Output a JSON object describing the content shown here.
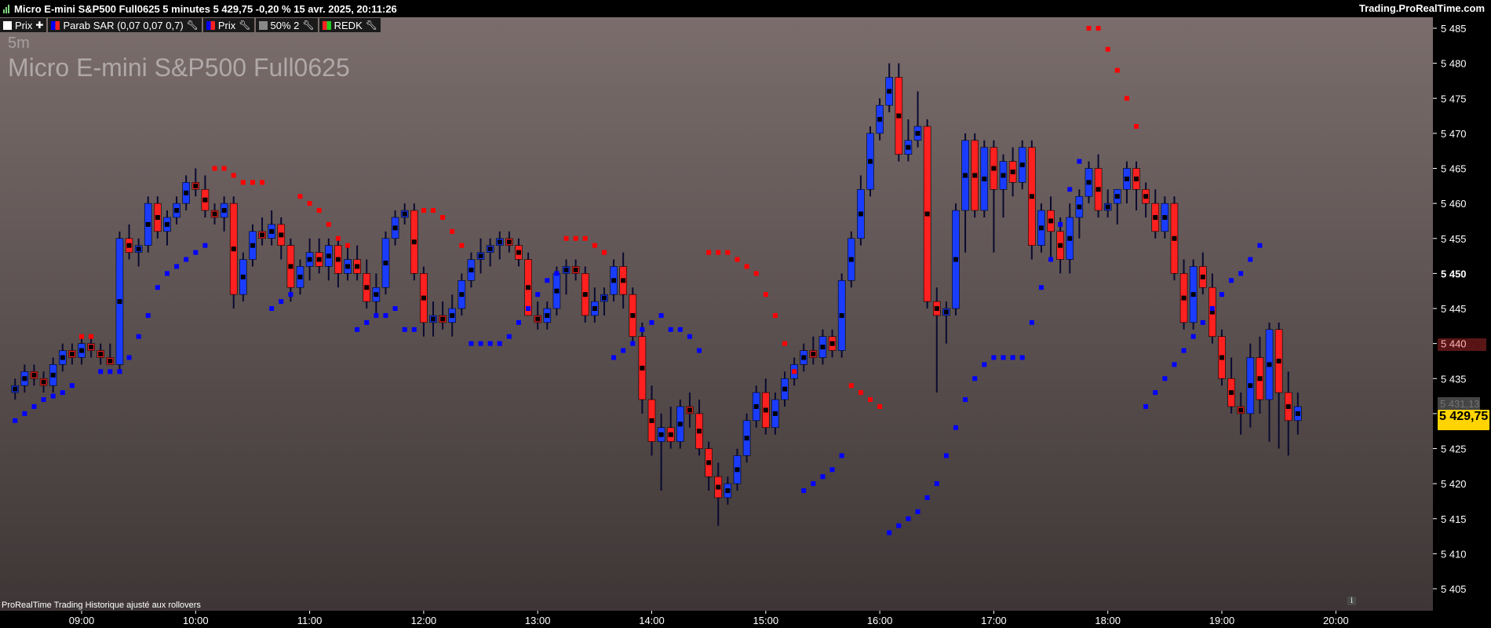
{
  "title": "Micro E-mini S&P500 Full0625 5 minutes 5 429,75 -0,20 % 15 avr. 2025, 20:11:26",
  "site": "Trading.ProRealTime.com",
  "legend": [
    {
      "label": "Prix",
      "swatch": "white",
      "tool": "plus-icon"
    },
    {
      "label": "Parab SAR (0,07 0,07 0,7)",
      "swatch": "split",
      "tool": "wrench-icon"
    },
    {
      "label": "Prix",
      "swatch": "split",
      "tool": "wrench-icon"
    },
    {
      "label": "50% 2",
      "swatch": "grey",
      "tool": "wrench-icon"
    },
    {
      "label": "REDK",
      "swatch": "rg",
      "tool": "wrench-icon"
    }
  ],
  "timeframe": "5m",
  "instrument": "Micro E-mini S&P500 Full0625",
  "footer": "ProRealTime Trading  Historique ajusté aux rollovers",
  "info_icon": "info-icon",
  "price_label": "5 429,75",
  "sar_label": "5 439,75",
  "mid_label": "5 431,13",
  "colors": {
    "up": "#1a3cff",
    "down": "#ff2020",
    "sar_up": "#0000ff",
    "sar_down": "#ff0000",
    "bar_mark": "#000000"
  },
  "chart_data": {
    "type": "candlestick",
    "y_ticks": [
      "5 405",
      "5 410",
      "5 415",
      "5 420",
      "5 425",
      "5 430",
      "5 435",
      "5 440",
      "5 445",
      "5 450",
      "5 455",
      "5 460",
      "5 465",
      "5 470",
      "5 475",
      "5 480",
      "5 485"
    ],
    "y_tick_values": [
      5405,
      5410,
      5415,
      5420,
      5425,
      5430,
      5435,
      5440,
      5445,
      5450,
      5455,
      5460,
      5465,
      5470,
      5475,
      5480,
      5485
    ],
    "x_ticks": [
      "09:00",
      "10:00",
      "11:00",
      "12:00",
      "13:00",
      "14:00",
      "15:00",
      "16:00",
      "17:00",
      "18:00",
      "19:00",
      "20:00"
    ],
    "ylim": [
      5402,
      5489
    ],
    "bars_per_hour": 12,
    "first_bar_offset_from_0900": -7,
    "ohlc": [
      [
        5433,
        5435,
        5432,
        5434
      ],
      [
        5434,
        5437,
        5433,
        5436
      ],
      [
        5436,
        5437,
        5434,
        5435
      ],
      [
        5435,
        5436,
        5433,
        5434
      ],
      [
        5434,
        5438,
        5433,
        5437
      ],
      [
        5437,
        5440,
        5436,
        5439
      ],
      [
        5439,
        5440,
        5437,
        5438
      ],
      [
        5438,
        5441,
        5437,
        5440
      ],
      [
        5440,
        5441,
        5438,
        5439
      ],
      [
        5439,
        5440,
        5437,
        5438
      ],
      [
        5438,
        5440,
        5437,
        5437
      ],
      [
        5437,
        5456,
        5436,
        5455
      ],
      [
        5455,
        5457,
        5452,
        5453
      ],
      [
        5453,
        5455,
        5451,
        5454
      ],
      [
        5454,
        5461,
        5453,
        5460
      ],
      [
        5460,
        5461,
        5455,
        5456
      ],
      [
        5456,
        5459,
        5454,
        5458
      ],
      [
        5458,
        5461,
        5457,
        5460
      ],
      [
        5460,
        5464,
        5459,
        5463
      ],
      [
        5463,
        5465,
        5461,
        5462
      ],
      [
        5462,
        5464,
        5458,
        5459
      ],
      [
        5459,
        5460,
        5457,
        5458
      ],
      [
        5458,
        5461,
        5456,
        5460
      ],
      [
        5460,
        5461,
        5445,
        5447
      ],
      [
        5447,
        5453,
        5446,
        5452
      ],
      [
        5452,
        5457,
        5451,
        5456
      ],
      [
        5456,
        5458,
        5454,
        5455
      ],
      [
        5455,
        5459,
        5454,
        5457
      ],
      [
        5457,
        5458,
        5452,
        5454
      ],
      [
        5454,
        5455,
        5446,
        5448
      ],
      [
        5448,
        5452,
        5447,
        5451
      ],
      [
        5451,
        5455,
        5449,
        5453
      ],
      [
        5453,
        5455,
        5450,
        5451
      ],
      [
        5451,
        5455,
        5449,
        5454
      ],
      [
        5454,
        5455,
        5448,
        5450
      ],
      [
        5450,
        5454,
        5449,
        5452
      ],
      [
        5452,
        5454,
        5449,
        5450
      ],
      [
        5450,
        5452,
        5445,
        5446
      ],
      [
        5446,
        5450,
        5444,
        5448
      ],
      [
        5448,
        5456,
        5447,
        5455
      ],
      [
        5455,
        5459,
        5454,
        5458
      ],
      [
        5458,
        5460,
        5457,
        5459
      ],
      [
        5459,
        5460,
        5449,
        5450
      ],
      [
        5450,
        5451,
        5441,
        5443
      ],
      [
        5443,
        5446,
        5441,
        5444
      ],
      [
        5444,
        5446,
        5442,
        5443
      ],
      [
        5443,
        5447,
        5441,
        5445
      ],
      [
        5445,
        5450,
        5444,
        5449
      ],
      [
        5449,
        5453,
        5448,
        5452
      ],
      [
        5452,
        5455,
        5450,
        5453
      ],
      [
        5453,
        5455,
        5451,
        5454
      ],
      [
        5454,
        5456,
        5452,
        5455
      ],
      [
        5455,
        5456,
        5453,
        5454
      ],
      [
        5454,
        5455,
        5451,
        5452
      ],
      [
        5452,
        5453,
        5447,
        5444
      ],
      [
        5444,
        5446,
        5442,
        5443
      ],
      [
        5443,
        5446,
        5442,
        5445
      ],
      [
        5445,
        5451,
        5444,
        5450
      ],
      [
        5450,
        5452,
        5447,
        5451
      ],
      [
        5451,
        5452,
        5449,
        5450
      ],
      [
        5450,
        5451,
        5443,
        5444
      ],
      [
        5444,
        5448,
        5443,
        5446
      ],
      [
        5446,
        5448,
        5444,
        5447
      ],
      [
        5447,
        5452,
        5446,
        5451
      ],
      [
        5451,
        5453,
        5445,
        5447
      ],
      [
        5447,
        5448,
        5440,
        5441
      ],
      [
        5441,
        5443,
        5430,
        5432
      ],
      [
        5432,
        5434,
        5424,
        5426
      ],
      [
        5426,
        5430,
        5419,
        5428
      ],
      [
        5428,
        5431,
        5425,
        5426
      ],
      [
        5426,
        5432,
        5425,
        5431
      ],
      [
        5431,
        5433,
        5428,
        5430
      ],
      [
        5430,
        5432,
        5424,
        5425
      ],
      [
        5425,
        5426,
        5419,
        5421
      ],
      [
        5421,
        5423,
        5414,
        5418
      ],
      [
        5418,
        5421,
        5417,
        5420
      ],
      [
        5420,
        5425,
        5419,
        5424
      ],
      [
        5424,
        5430,
        5423,
        5429
      ],
      [
        5429,
        5434,
        5428,
        5433
      ],
      [
        5433,
        5435,
        5427,
        5428
      ],
      [
        5428,
        5433,
        5427,
        5432
      ],
      [
        5432,
        5436,
        5431,
        5435
      ],
      [
        5435,
        5438,
        5434,
        5437
      ],
      [
        5437,
        5440,
        5436,
        5439
      ],
      [
        5439,
        5441,
        5437,
        5438
      ],
      [
        5438,
        5442,
        5437,
        5441
      ],
      [
        5441,
        5442,
        5438,
        5439
      ],
      [
        5439,
        5450,
        5438,
        5449
      ],
      [
        5449,
        5456,
        5448,
        5455
      ],
      [
        5455,
        5464,
        5454,
        5462
      ],
      [
        5462,
        5471,
        5461,
        5470
      ],
      [
        5470,
        5475,
        5469,
        5474
      ],
      [
        5474,
        5480,
        5473,
        5478
      ],
      [
        5478,
        5480,
        5466,
        5467
      ],
      [
        5467,
        5472,
        5466,
        5469
      ],
      [
        5469,
        5476,
        5468,
        5471
      ],
      [
        5471,
        5472,
        5445,
        5446
      ],
      [
        5446,
        5448,
        5433,
        5444
      ],
      [
        5444,
        5446,
        5440,
        5445
      ],
      [
        5445,
        5460,
        5444,
        5459
      ],
      [
        5459,
        5470,
        5453,
        5469
      ],
      [
        5469,
        5470,
        5458,
        5459
      ],
      [
        5459,
        5469,
        5458,
        5468
      ],
      [
        5468,
        5469,
        5453,
        5462
      ],
      [
        5462,
        5467,
        5458,
        5466
      ],
      [
        5466,
        5468,
        5461,
        5463
      ],
      [
        5463,
        5469,
        5462,
        5468
      ],
      [
        5468,
        5469,
        5452,
        5454
      ],
      [
        5454,
        5460,
        5453,
        5459
      ],
      [
        5459,
        5461,
        5452,
        5456
      ],
      [
        5456,
        5458,
        5450,
        5452
      ],
      [
        5452,
        5460,
        5450,
        5458
      ],
      [
        5458,
        5462,
        5455,
        5461
      ],
      [
        5461,
        5466,
        5460,
        5465
      ],
      [
        5465,
        5467,
        5458,
        5459
      ],
      [
        5459,
        5462,
        5458,
        5460
      ],
      [
        5460,
        5462,
        5457,
        5462
      ],
      [
        5462,
        5466,
        5460,
        5465
      ],
      [
        5465,
        5466,
        5459,
        5462
      ],
      [
        5462,
        5463,
        5458,
        5460
      ],
      [
        5460,
        5462,
        5455,
        5456
      ],
      [
        5456,
        5461,
        5455,
        5460
      ],
      [
        5460,
        5461,
        5449,
        5450
      ],
      [
        5450,
        5452,
        5442,
        5443
      ],
      [
        5443,
        5452,
        5442,
        5451
      ],
      [
        5451,
        5453,
        5447,
        5448
      ],
      [
        5448,
        5450,
        5440,
        5441
      ],
      [
        5441,
        5442,
        5434,
        5435
      ],
      [
        5435,
        5438,
        5430,
        5431
      ],
      [
        5431,
        5433,
        5427,
        5430
      ],
      [
        5430,
        5440,
        5428,
        5438
      ],
      [
        5438,
        5441,
        5430,
        5432
      ],
      [
        5432,
        5443,
        5426,
        5442
      ],
      [
        5442,
        5443,
        5425,
        5433
      ],
      [
        5433,
        5436,
        5424,
        5429
      ],
      [
        5429,
        5433,
        5427,
        5431
      ]
    ],
    "sar": [
      {
        "v": 5429,
        "d": "up"
      },
      {
        "v": 5430,
        "d": "up"
      },
      {
        "v": 5431,
        "d": "up"
      },
      {
        "v": 5432,
        "d": "up"
      },
      {
        "v": 5432.5,
        "d": "up"
      },
      {
        "v": 5433,
        "d": "up"
      },
      {
        "v": 5434,
        "d": "up"
      },
      {
        "v": 5441,
        "d": "down"
      },
      {
        "v": 5441,
        "d": "down"
      },
      {
        "v": 5436,
        "d": "up"
      },
      {
        "v": 5436,
        "d": "up"
      },
      {
        "v": 5436,
        "d": "up"
      },
      {
        "v": 5438,
        "d": "up"
      },
      {
        "v": 5441,
        "d": "up"
      },
      {
        "v": 5444,
        "d": "up"
      },
      {
        "v": 5448,
        "d": "up"
      },
      {
        "v": 5450,
        "d": "up"
      },
      {
        "v": 5451,
        "d": "up"
      },
      {
        "v": 5452,
        "d": "up"
      },
      {
        "v": 5453,
        "d": "up"
      },
      {
        "v": 5454,
        "d": "up"
      },
      {
        "v": 5465,
        "d": "down"
      },
      {
        "v": 5465,
        "d": "down"
      },
      {
        "v": 5464,
        "d": "down"
      },
      {
        "v": 5463,
        "d": "down"
      },
      {
        "v": 5463,
        "d": "down"
      },
      {
        "v": 5463,
        "d": "down"
      },
      {
        "v": 5445,
        "d": "up"
      },
      {
        "v": 5446,
        "d": "up"
      },
      {
        "v": 5447,
        "d": "up"
      },
      {
        "v": 5461,
        "d": "down"
      },
      {
        "v": 5460,
        "d": "down"
      },
      {
        "v": 5459,
        "d": "down"
      },
      {
        "v": 5457,
        "d": "down"
      },
      {
        "v": 5455,
        "d": "down"
      },
      {
        "v": 5454,
        "d": "down"
      },
      {
        "v": 5442,
        "d": "up"
      },
      {
        "v": 5443,
        "d": "up"
      },
      {
        "v": 5444,
        "d": "up"
      },
      {
        "v": 5444,
        "d": "up"
      },
      {
        "v": 5445,
        "d": "up"
      },
      {
        "v": 5442,
        "d": "up"
      },
      {
        "v": 5442,
        "d": "up"
      },
      {
        "v": 5459,
        "d": "down"
      },
      {
        "v": 5459,
        "d": "down"
      },
      {
        "v": 5458,
        "d": "down"
      },
      {
        "v": 5456,
        "d": "down"
      },
      {
        "v": 5454,
        "d": "down"
      },
      {
        "v": 5440,
        "d": "up"
      },
      {
        "v": 5440,
        "d": "up"
      },
      {
        "v": 5440,
        "d": "up"
      },
      {
        "v": 5440,
        "d": "up"
      },
      {
        "v": 5441,
        "d": "up"
      },
      {
        "v": 5443,
        "d": "up"
      },
      {
        "v": 5445,
        "d": "up"
      },
      {
        "v": 5447,
        "d": "up"
      },
      {
        "v": 5449,
        "d": "up"
      },
      {
        "v": 5450,
        "d": "up"
      },
      {
        "v": 5455,
        "d": "down"
      },
      {
        "v": 5455,
        "d": "down"
      },
      {
        "v": 5455,
        "d": "down"
      },
      {
        "v": 5454,
        "d": "down"
      },
      {
        "v": 5453,
        "d": "down"
      },
      {
        "v": 5438,
        "d": "up"
      },
      {
        "v": 5439,
        "d": "up"
      },
      {
        "v": 5440,
        "d": "up"
      },
      {
        "v": 5442,
        "d": "up"
      },
      {
        "v": 5443,
        "d": "up"
      },
      {
        "v": 5444,
        "d": "up"
      },
      {
        "v": 5442,
        "d": "up"
      },
      {
        "v": 5442,
        "d": "up"
      },
      {
        "v": 5441,
        "d": "up"
      },
      {
        "v": 5439,
        "d": "up"
      },
      {
        "v": 5453,
        "d": "down"
      },
      {
        "v": 5453,
        "d": "down"
      },
      {
        "v": 5453,
        "d": "down"
      },
      {
        "v": 5452,
        "d": "down"
      },
      {
        "v": 5451,
        "d": "down"
      },
      {
        "v": 5450,
        "d": "down"
      },
      {
        "v": 5447,
        "d": "down"
      },
      {
        "v": 5444,
        "d": "down"
      },
      {
        "v": 5440,
        "d": "down"
      },
      {
        "v": 5436,
        "d": "down"
      },
      {
        "v": 5419,
        "d": "up"
      },
      {
        "v": 5420,
        "d": "up"
      },
      {
        "v": 5421,
        "d": "up"
      },
      {
        "v": 5422,
        "d": "up"
      },
      {
        "v": 5424,
        "d": "up"
      },
      {
        "v": 5434,
        "d": "down"
      },
      {
        "v": 5433,
        "d": "down"
      },
      {
        "v": 5432,
        "d": "down"
      },
      {
        "v": 5431,
        "d": "down"
      },
      {
        "v": 5413,
        "d": "up"
      },
      {
        "v": 5414,
        "d": "up"
      },
      {
        "v": 5415,
        "d": "up"
      },
      {
        "v": 5416,
        "d": "up"
      },
      {
        "v": 5418,
        "d": "up"
      },
      {
        "v": 5420,
        "d": "up"
      },
      {
        "v": 5424,
        "d": "up"
      },
      {
        "v": 5428,
        "d": "up"
      },
      {
        "v": 5432,
        "d": "up"
      },
      {
        "v": 5435,
        "d": "up"
      },
      {
        "v": 5437,
        "d": "up"
      },
      {
        "v": 5438,
        "d": "up"
      },
      {
        "v": 5438,
        "d": "up"
      },
      {
        "v": 5438,
        "d": "up"
      },
      {
        "v": 5438,
        "d": "up"
      },
      {
        "v": 5443,
        "d": "up"
      },
      {
        "v": 5448,
        "d": "up"
      },
      {
        "v": 5452,
        "d": "up"
      },
      {
        "v": 5457,
        "d": "up"
      },
      {
        "v": 5462,
        "d": "up"
      },
      {
        "v": 5466,
        "d": "up"
      },
      {
        "v": 5485,
        "d": "down"
      },
      {
        "v": 5485,
        "d": "down"
      },
      {
        "v": 5482,
        "d": "down"
      },
      {
        "v": 5479,
        "d": "down"
      },
      {
        "v": 5475,
        "d": "down"
      },
      {
        "v": 5471,
        "d": "down"
      },
      {
        "v": 5431,
        "d": "up"
      },
      {
        "v": 5433,
        "d": "up"
      },
      {
        "v": 5435,
        "d": "up"
      },
      {
        "v": 5437,
        "d": "up"
      },
      {
        "v": 5439,
        "d": "up"
      },
      {
        "v": 5441,
        "d": "up"
      },
      {
        "v": 5443,
        "d": "up"
      },
      {
        "v": 5445,
        "d": "up"
      },
      {
        "v": 5447,
        "d": "up"
      },
      {
        "v": 5449,
        "d": "up"
      },
      {
        "v": 5450,
        "d": "up"
      },
      {
        "v": 5452,
        "d": "up"
      },
      {
        "v": 5454,
        "d": "up"
      }
    ]
  }
}
